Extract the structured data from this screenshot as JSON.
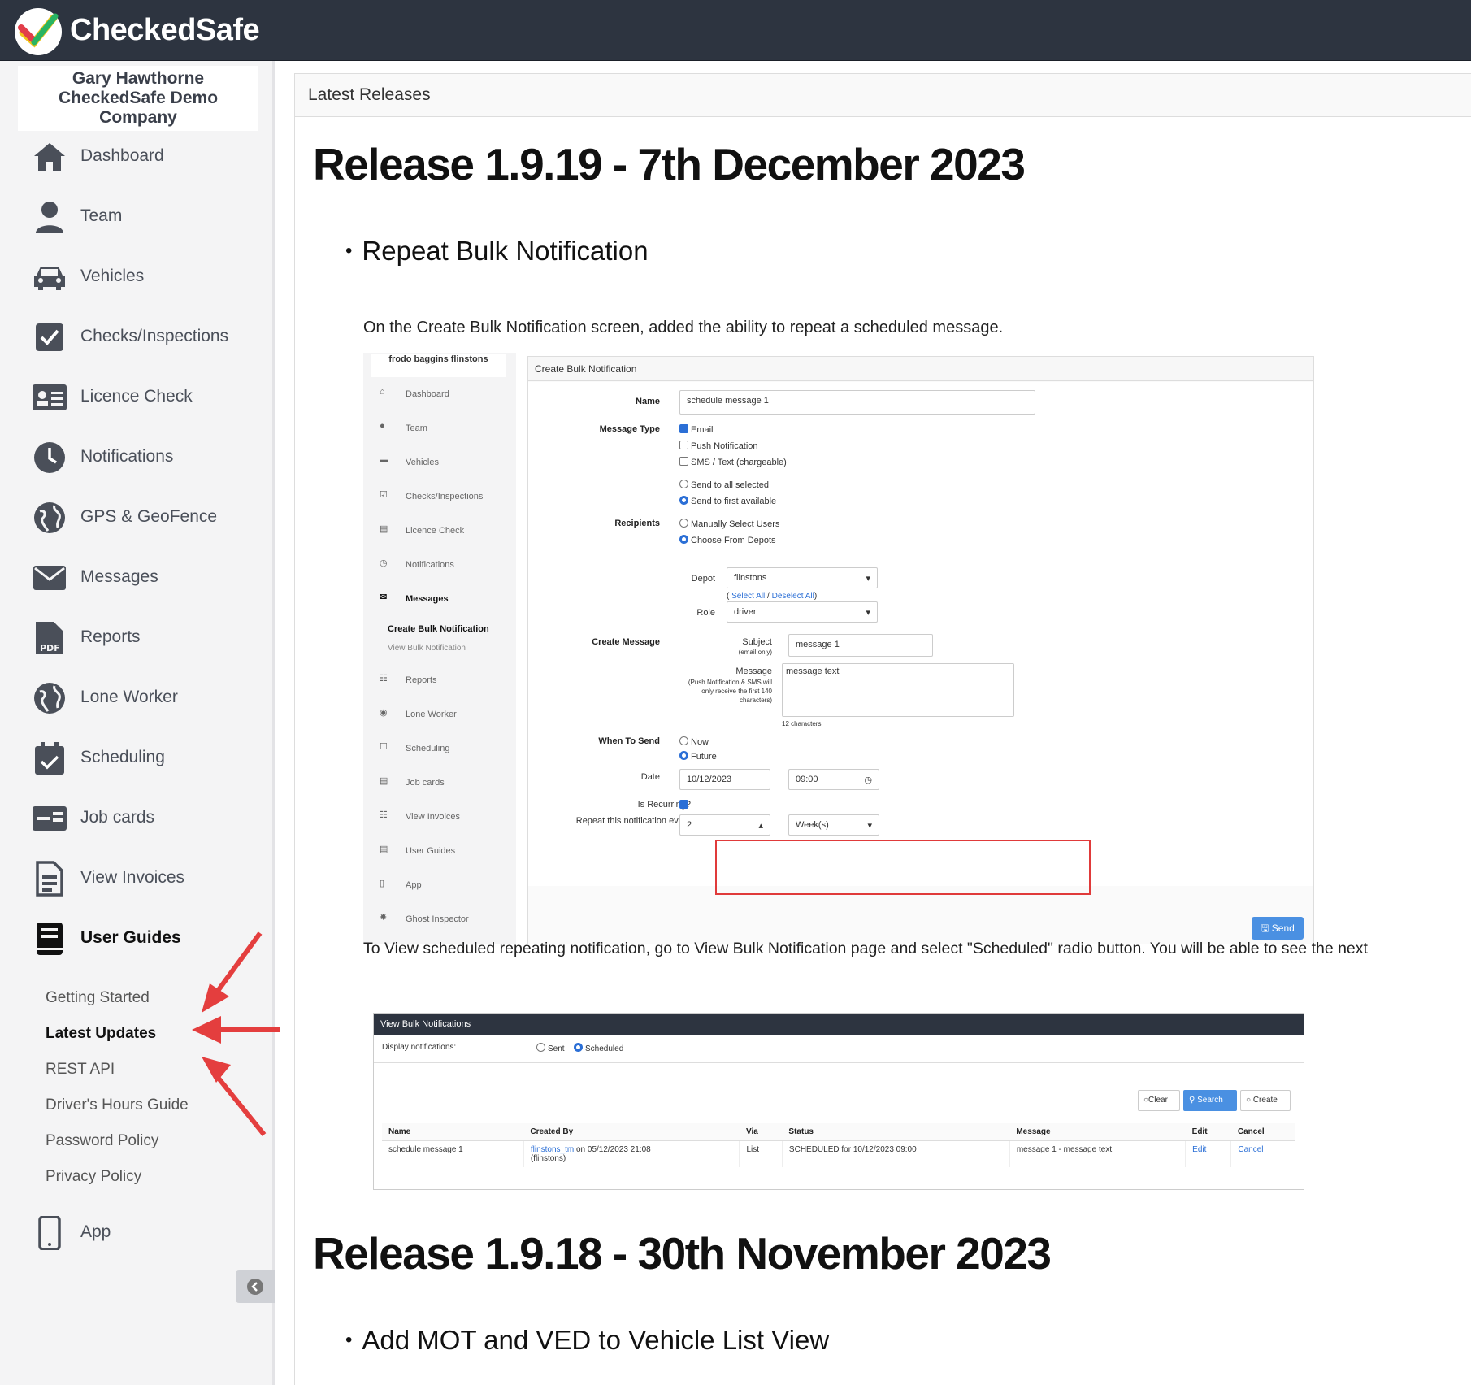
{
  "app": {
    "name": "CheckedSafe"
  },
  "sidebar": {
    "company": "Gary Hawthorne CheckedSafe Demo Company",
    "items": [
      {
        "label": "Dashboard",
        "icon": "home-icon"
      },
      {
        "label": "Team",
        "icon": "user-icon"
      },
      {
        "label": "Vehicles",
        "icon": "car-icon"
      },
      {
        "label": "Checks/Inspections",
        "icon": "checkbox-icon"
      },
      {
        "label": "Licence Check",
        "icon": "id-card-icon"
      },
      {
        "label": "Notifications",
        "icon": "clock-icon"
      },
      {
        "label": "GPS & GeoFence",
        "icon": "globe-icon"
      },
      {
        "label": "Messages",
        "icon": "envelope-icon"
      },
      {
        "label": "Reports",
        "icon": "pdf-icon"
      },
      {
        "label": "Lone Worker",
        "icon": "globe-icon"
      },
      {
        "label": "Scheduling",
        "icon": "calendar-icon"
      },
      {
        "label": "Job cards",
        "icon": "card-icon"
      },
      {
        "label": "View Invoices",
        "icon": "invoice-icon"
      },
      {
        "label": "User Guides",
        "icon": "book-icon"
      }
    ],
    "sub_items": [
      "Getting Started",
      "Latest Updates",
      "REST API",
      "Driver's Hours Guide",
      "Password Policy",
      "Privacy Policy"
    ],
    "app_label": "App"
  },
  "main": {
    "breadcrumb": "Latest Releases",
    "release1": {
      "title": "Release 1.9.19 - 7th December 2023",
      "feature": "Repeat Bulk Notification",
      "intro": "On the Create Bulk Notification screen, added the ability to repeat a scheduled message.",
      "outro": "To View scheduled repeating notification, go to View Bulk Notification page and select \"Scheduled\" radio button. You will be able to see the next"
    },
    "release2": {
      "title": "Release 1.9.18 - 30th November 2023",
      "feature": "Add MOT and VED to Vehicle List View"
    }
  },
  "shot1": {
    "user": "frodo baggins flinstons",
    "nav": [
      "Dashboard",
      "Team",
      "Vehicles",
      "Checks/Inspections",
      "Licence Check",
      "Notifications",
      "Messages",
      "Create Bulk Notification",
      "View Bulk Notification",
      "Reports",
      "Lone Worker",
      "Scheduling",
      "Job cards",
      "View Invoices",
      "User Guides",
      "App",
      "Ghost Inspector"
    ],
    "panel_title": "Create Bulk Notification",
    "name_label": "Name",
    "name_value": "schedule message 1",
    "msgtype_label": "Message Type",
    "msgtype_opts": [
      "Email",
      "Push Notification",
      "SMS / Text (chargeable)"
    ],
    "send_opts": [
      "Send to all selected",
      "Send to first available"
    ],
    "recipients_label": "Recipients",
    "recipient_opts": [
      "Manually Select Users",
      "Choose From Depots"
    ],
    "depot_label": "Depot",
    "depot_value": "flinstons",
    "select_all": "Select All",
    "deselect_all": "Deselect All",
    "role_label": "Role",
    "role_value": "driver",
    "create_msg_label": "Create Message",
    "subject_label": "Subject",
    "subject_note": "(email only)",
    "subject_value": "message 1",
    "message_label": "Message",
    "message_note": "(Push Notification & SMS will only receive the first 140 characters)",
    "message_value": "message text",
    "char_count": "12 characters",
    "when_label": "When To Send",
    "when_opts": [
      "Now",
      "Future"
    ],
    "date_label": "Date",
    "date_value": "10/12/2023",
    "time_value": "09:00",
    "recurring_label": "Is Recurring?",
    "repeat_label": "Repeat this notification every",
    "repeat_value": "2",
    "repeat_unit": "Week(s)",
    "send_btn": "Send"
  },
  "shot2": {
    "title": "View Bulk Notifications",
    "display_label": "Display notifications:",
    "opts": [
      "Sent",
      "Scheduled"
    ],
    "buttons": [
      "Clear",
      "Search",
      "Create"
    ],
    "headers": [
      "Name",
      "Created By",
      "Via",
      "Status",
      "Message",
      "Edit",
      "Cancel"
    ],
    "row": {
      "name": "schedule message 1",
      "created_link": "flinstons_tm",
      "created_rest": " on 05/12/2023 21:08",
      "created_sub": "(flinstons)",
      "via": "List",
      "status": "SCHEDULED for 10/12/2023 09:00",
      "message": "message 1 - message text",
      "edit": "Edit",
      "cancel": "Cancel"
    }
  },
  "colors": {
    "topbar": "#2d3440",
    "accent": "#4a90e2",
    "highlight": "#e03a3a"
  }
}
